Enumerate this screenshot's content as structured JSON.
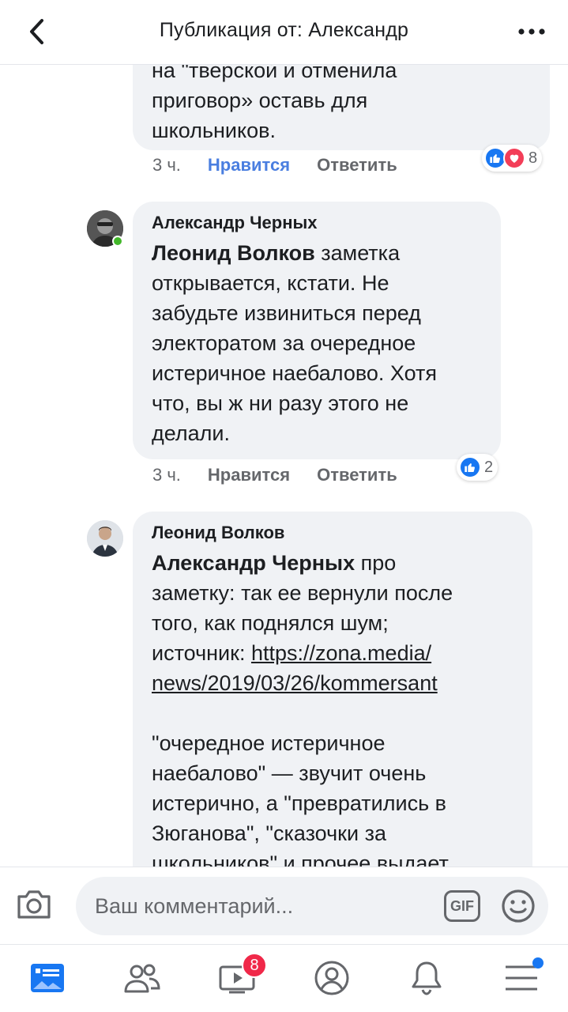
{
  "header": {
    "title": "Публикация от: Александр"
  },
  "comments": [
    {
      "text_lines": [
        "на \"тверской и отменила",
        "приговор» оставь для",
        "школьников."
      ],
      "time": "3 ч.",
      "like_label": "Нравится",
      "reply_label": "Ответить",
      "reaction_count": "8",
      "reactions": [
        "like",
        "love"
      ]
    },
    {
      "author": "Александр Черных",
      "mention": "Леонид Волков",
      "text_lines": [
        "заметка",
        "открывается, кстати. Не",
        "забудьте извиниться перед",
        "электоратом за очередное",
        "истеричное наебалово. Хотя",
        "что, вы ж ни разу этого не",
        "делали."
      ],
      "time": "3 ч.",
      "like_label": "Нравится",
      "reply_label": "Ответить",
      "reaction_count": "2",
      "reactions": [
        "like"
      ],
      "online": true
    },
    {
      "author": "Леонид Волков",
      "mention": "Александр Черных",
      "text_lines": [
        "про",
        "заметку: так ее вернули после",
        "того, как поднялся шум;",
        "источник:"
      ],
      "link_lines": [
        "https://zona.media/",
        "news/2019/03/26/kommersant"
      ],
      "text_lines_2": [
        "\"очередное истеричное",
        "наебалово\" — звучит очень",
        "истерично, а \"превратились в",
        "Зюганова\", \"сказочки за",
        "школьников\" и прочее выдает"
      ]
    }
  ],
  "composer": {
    "placeholder": "Ваш комментарий...",
    "gif_label": "GIF"
  },
  "tabbar": {
    "items": [
      "news-feed",
      "friends",
      "watch",
      "profile",
      "notifications",
      "menu"
    ],
    "watch_badge": "8"
  },
  "icons": {
    "back": "chevron-left-icon",
    "more": "more-dots-icon",
    "camera": "camera-icon",
    "emoji": "smiley-icon"
  },
  "colors": {
    "accent": "#1877f2",
    "like_active": "#4a7ee0",
    "bubble": "#f0f2f5",
    "badge": "#f02849",
    "online": "#42b72a"
  }
}
